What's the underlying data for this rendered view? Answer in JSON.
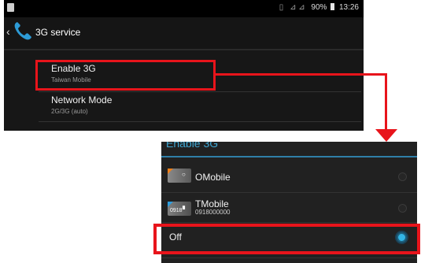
{
  "status_bar": {
    "battery": "90%",
    "time": "13:26",
    "icons": [
      "sim-icon",
      "vibrate-icon",
      "signal-icon",
      "battery-icon"
    ]
  },
  "action_bar": {
    "title": "3G service",
    "icon": "phone-icon"
  },
  "settings": {
    "items": [
      {
        "title": "Enable 3G",
        "subtitle": "Taiwan Mobile"
      },
      {
        "title": "Network Mode",
        "subtitle": "2G/3G (auto)"
      }
    ]
  },
  "dialog": {
    "title": "Enable 3G",
    "options": [
      {
        "label": "OMobile",
        "sub": "",
        "selected": false
      },
      {
        "label": "TMobile",
        "sub": "0918000000",
        "icon_text": "0918",
        "selected": false
      },
      {
        "label": "Off",
        "sub": "",
        "selected": true
      }
    ]
  },
  "colors": {
    "highlight": "#e8141b",
    "accent": "#33b5e5",
    "dialog_title": "#3fa6d2"
  }
}
